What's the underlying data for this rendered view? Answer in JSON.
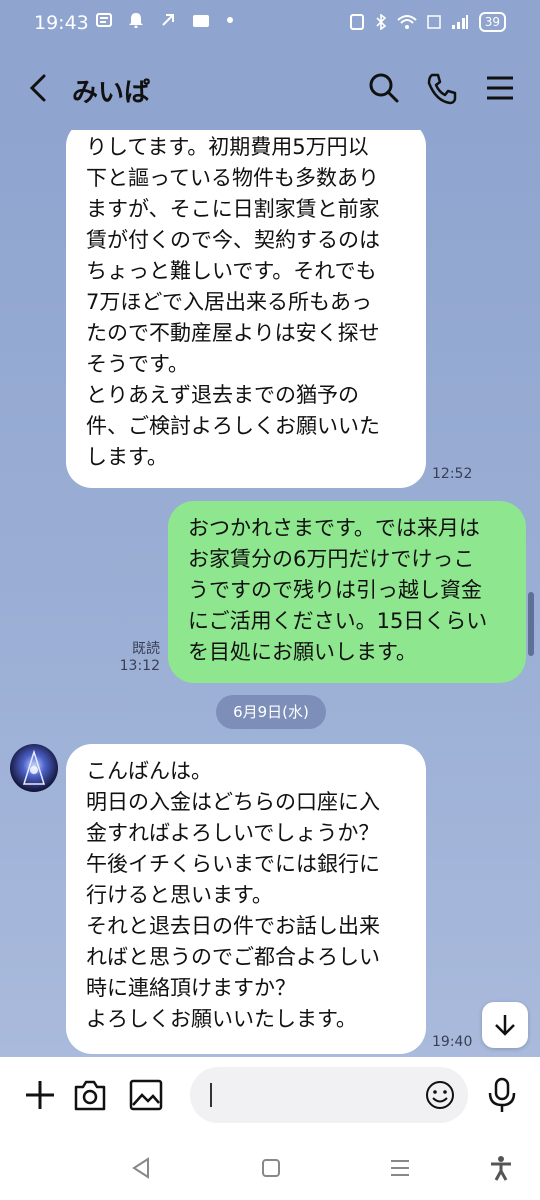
{
  "status": {
    "time": "19:43",
    "battery": "39"
  },
  "header": {
    "title": "みいぱ"
  },
  "messages": [
    {
      "side": "in",
      "text": "りしてます。初期費用5万円以\n下と謳っている物件も多数あり\nますが、そこに日割家賃と前家\n賃が付くので今、契約するのは\nちょっと難しいです。それでも\n7万ほどで入居出来る所もあっ\nたので不動産屋よりは安く探せ\nそうです。\nとりあえず退去までの猶予の\n件、ご検討よろしくお願いいた\nします。",
      "time": "12:52"
    },
    {
      "side": "out",
      "text": "おつかれさまです。では来月は\nお家賃分の6万円だけでけっこ\nうですので残りは引っ越し資金\nにご活用ください。15日くらい\nを目処にお願いします。",
      "read": "既読",
      "time": "13:12"
    },
    {
      "side": "in",
      "text": "こんばんは。\n明日の入金はどちらの口座に入\n金すればよろしいでしょうか？\n午後イチくらいまでには銀行に\n行けると思います。\nそれと退去日の件でお話し出来\nればと思うのでご都合よろしい\n時に連絡頂けますか？\nよろしくお願いいたします。",
      "time": "19:40"
    }
  ],
  "date_separator": "6月9日(水)",
  "icons": {
    "back": "back-arrow-icon",
    "search": "search-icon",
    "call": "phone-icon",
    "menu": "menu-icon",
    "add": "plus-icon",
    "camera": "camera-icon",
    "image": "image-icon",
    "emoji": "emoji-icon",
    "mic": "microphone-icon",
    "scroll_down": "arrow-down-icon"
  },
  "colors": {
    "chat_bg": "#8fa5cf",
    "outgoing": "#8ee78e",
    "incoming": "#ffffff"
  }
}
